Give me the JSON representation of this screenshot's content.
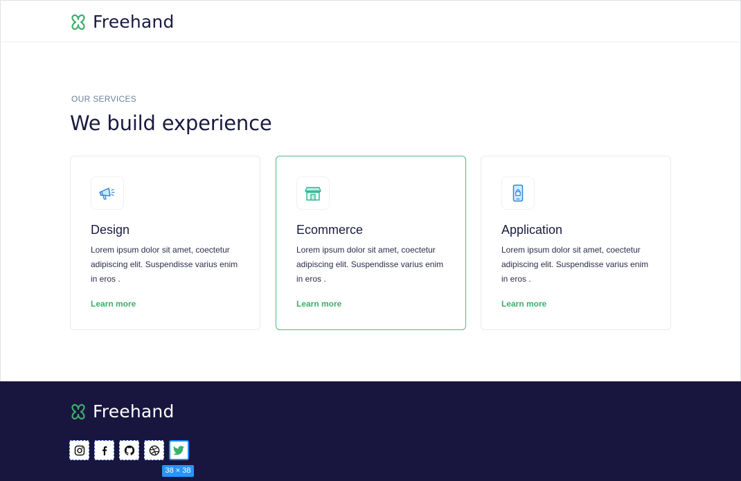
{
  "brand": {
    "name": "Freehand",
    "accent": "#3dae6b",
    "dark": "#18163f"
  },
  "services": {
    "eyebrow": "OUR SERVICES",
    "heading": "We build experience",
    "cards": [
      {
        "icon": "megaphone-icon",
        "title": "Design",
        "description": "Lorem ipsum dolor sit amet, coectetur adipiscing elit. Suspendisse varius enim in eros .",
        "link": "Learn more"
      },
      {
        "icon": "storefront-icon",
        "title": "Ecommerce",
        "description": "Lorem ipsum dolor sit amet, coectetur adipiscing elit. Suspendisse varius enim in eros .",
        "link": "Learn more"
      },
      {
        "icon": "mobile-lock-icon",
        "title": "Application",
        "description": "Lorem ipsum dolor sit amet, coectetur adipiscing elit. Suspendisse varius enim in eros .",
        "link": "Learn more"
      }
    ]
  },
  "footer": {
    "socials": [
      "instagram-icon",
      "facebook-icon",
      "github-icon",
      "dribbble-icon",
      "twitter-icon"
    ],
    "size_tag": "38 × 38"
  }
}
